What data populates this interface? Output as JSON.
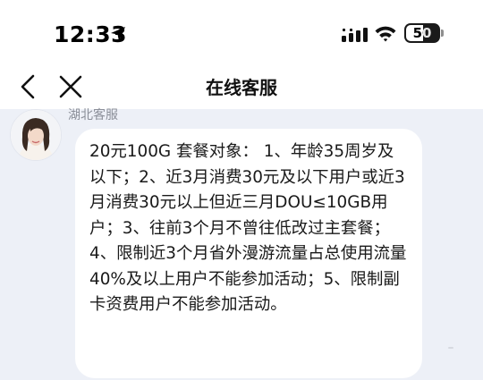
{
  "status_bar": {
    "time": "12:33",
    "battery": "50",
    "icons": [
      "location-arrow-icon",
      "signal-icon",
      "wifi-icon",
      "battery-icon"
    ]
  },
  "nav": {
    "title": "在线客服",
    "icons": [
      "chevron-left-icon",
      "close-icon"
    ]
  },
  "chat": {
    "sender_name": "湖北客服",
    "message": "20元100G 套餐对象： 1、年龄35周岁及以下；2、近3月消费30元及以下用户或近3月消费30元以上但近三月DOU≤10GB用户；3、往前3个月不曾往低改过主套餐；4、限制近3个月省外漫游流量占总使用流量40%及以上用户不能参加活动；5、限制副卡资费用户不能参加活动。"
  },
  "colors": {
    "chat_background": "#edf0f7",
    "bubble": "#ffffff",
    "text": "#1a1a1a"
  }
}
